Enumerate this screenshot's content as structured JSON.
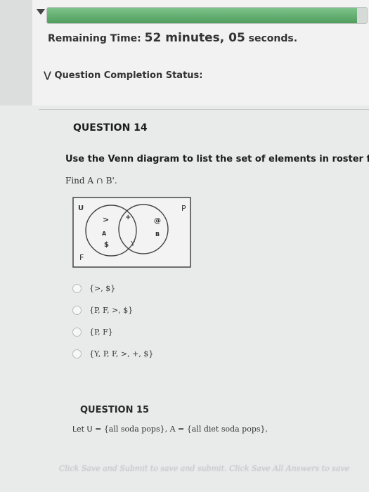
{
  "header": {
    "timer_label": "Remaining Time: ",
    "timer_value": "52 minutes, 05",
    "timer_suffix": " seconds.",
    "status_label": "Question Completion Status:",
    "progress_fraction": 0.97,
    "progress_color": "#5fae6c"
  },
  "question14": {
    "title": "QUESTION 14",
    "prompt": "Use the Venn diagram to list the set of elements in roster f",
    "find": "Find A ∩ B'.",
    "venn": {
      "universe_label": "U",
      "p_label": "P",
      "f_label": "F",
      "set_a_label": "A",
      "set_b_label": "B",
      "gt_symbol": ">",
      "dollar_symbol": "$",
      "plus_symbol": "+",
      "y_symbol": "Y",
      "at_symbol": "@"
    },
    "options": [
      {
        "label": "{>, $}"
      },
      {
        "label": "{P, F, >, $}"
      },
      {
        "label": "{P, F}"
      },
      {
        "label": "{Y, P, F, >, +, $}"
      }
    ]
  },
  "question15": {
    "title": "QUESTION 15",
    "text_lead": "Let U",
    "text_rest": "= {all soda pops}, A = {all diet soda pops},"
  },
  "footer": {
    "hint": "Click Save and Submit to save and submit. Click Save All Answers to save"
  }
}
